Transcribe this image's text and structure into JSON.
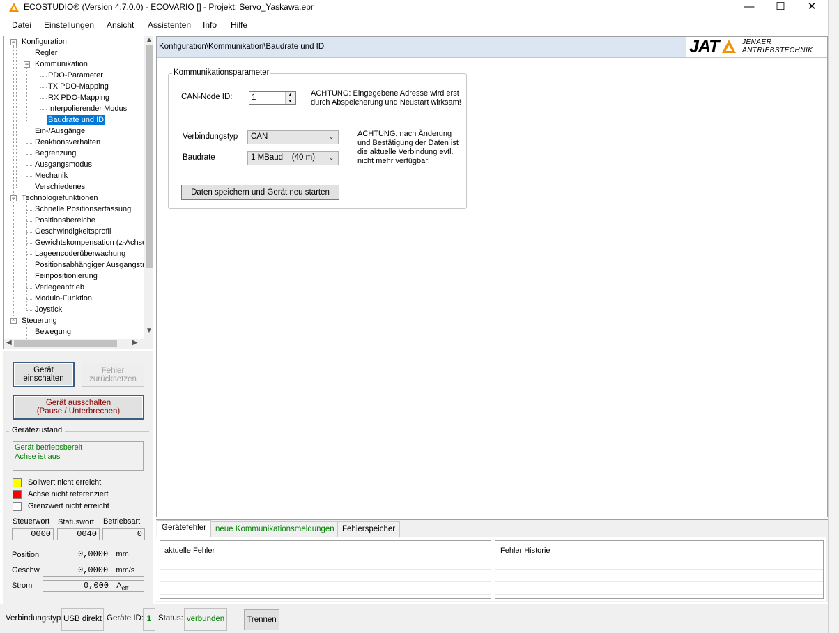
{
  "window": {
    "title": "ECOSTUDIO® (Version 4.7.0.0) - ECOVARIO [] - Projekt: Servo_Yaskawa.epr",
    "minimize": "—",
    "maximize": "☐",
    "close": "✕"
  },
  "menu": [
    "Datei",
    "Einstellungen",
    "Ansicht",
    "Assistenten",
    "Info",
    "Hilfe"
  ],
  "tree": [
    {
      "label": "Konfiguration",
      "level": 0,
      "expanded": true
    },
    {
      "label": "Regler",
      "level": 1
    },
    {
      "label": "Kommunikation",
      "level": 1,
      "expanded": true
    },
    {
      "label": "PDO-Parameter",
      "level": 2
    },
    {
      "label": "TX PDO-Mapping",
      "level": 2
    },
    {
      "label": "RX PDO-Mapping",
      "level": 2
    },
    {
      "label": "Interpolierender Modus",
      "level": 2
    },
    {
      "label": "Baudrate und ID",
      "level": 2,
      "selected": true
    },
    {
      "label": "Ein-/Ausgänge",
      "level": 1
    },
    {
      "label": "Reaktionsverhalten",
      "level": 1
    },
    {
      "label": "Begrenzung",
      "level": 1
    },
    {
      "label": "Ausgangsmodus",
      "level": 1
    },
    {
      "label": "Mechanik",
      "level": 1
    },
    {
      "label": "Verschiedenes",
      "level": 1
    },
    {
      "label": "Technologiefunktionen",
      "level": 0,
      "expanded": true
    },
    {
      "label": "Schnelle Positionserfassung",
      "level": 1
    },
    {
      "label": "Positionsbereiche",
      "level": 1
    },
    {
      "label": "Geschwindigkeitsprofil",
      "level": 1
    },
    {
      "label": "Gewichtskompensation (z-Achse",
      "level": 1
    },
    {
      "label": "Lageencoderüberwachung",
      "level": 1
    },
    {
      "label": "Positionsabhängiger Ausgangstri",
      "level": 1
    },
    {
      "label": "Feinpositionierung",
      "level": 1
    },
    {
      "label": "Verlegeantrieb",
      "level": 1
    },
    {
      "label": "Modulo-Funktion",
      "level": 1
    },
    {
      "label": "Joystick",
      "level": 1
    },
    {
      "label": "Steuerung",
      "level": 0,
      "expanded": true
    },
    {
      "label": "Bewegung",
      "level": 1
    }
  ],
  "controls": {
    "einschalten": "Gerät einschalten",
    "fehler_reset": "Fehler zurücksetzen",
    "ausschalten_line1": "Gerät ausschalten",
    "ausschalten_line2": "(Pause / Unterbrechen)",
    "geraetezustand_title": "Gerätezustand",
    "zustand_line1": "Gerät betriebsbereit",
    "zustand_line2": "Achse ist aus",
    "indicators": [
      {
        "label": "Sollwert nicht erreicht",
        "color": "#ffff00"
      },
      {
        "label": "Achse nicht referenziert",
        "color": "#ff0000"
      },
      {
        "label": "Grenzwert nicht erreicht",
        "color": "#ffffff"
      }
    ],
    "steuerwort_label": "Steuerwort",
    "statuswort_label": "Statuswort",
    "betriebsart_label": "Betriebsart",
    "steuerwort": "0000",
    "statuswort": "0040",
    "betriebsart": "0",
    "position_label": "Position",
    "position_value": "0,0000",
    "position_unit": "mm",
    "geschw_label": "Geschw.",
    "geschw_value": "0,0000",
    "geschw_unit": "mm/s",
    "strom_label": "Strom",
    "strom_value": "0,000",
    "strom_unit": "A",
    "strom_unit_sub": "eff"
  },
  "main": {
    "path": "Konfiguration\\Kommunikation\\Baudrate und ID",
    "logo_text": "JAT",
    "logo_sub1": "JENAER",
    "logo_sub2": "ANTRIEBSTECHNIK",
    "group_title": "Kommunikationsparameter",
    "node_id_label": "CAN-Node ID:",
    "node_id_value": "1",
    "warning1_line1": "ACHTUNG: Eingegebene Adresse wird erst",
    "warning1_line2": "durch Abspeicherung und Neustart wirksam!",
    "verbindungstyp_label": "Verbindungstyp",
    "verbindungstyp_value": "CAN",
    "baudrate_label": "Baudrate",
    "baudrate_value": "1 MBaud    (40 m)",
    "warning2_line1": "ACHTUNG: nach Änderung",
    "warning2_line2": "und Bestätigung der Daten ist",
    "warning2_line3": "die aktuelle Verbindung evtl.",
    "warning2_line4": "nicht mehr verfügbar!",
    "save_button": "Daten speichern und Gerät neu starten"
  },
  "tabs": {
    "items": [
      "Gerätefehler",
      "neue Kommunikationsmeldungen",
      "Fehlerspeicher"
    ],
    "aktuelle_fehler": "aktuelle Fehler",
    "fehler_historie": "Fehler Historie"
  },
  "statusbar": {
    "verbindungstyp_label": "Verbindungstyp:",
    "verbindungstyp_value": "USB direkt",
    "geraete_id_label": "Geräte ID:",
    "geraete_id_value": "1",
    "status_label": "Status:",
    "status_value": "verbunden",
    "trennen": "Trennen"
  },
  "colors": {
    "accent_green": "#008000",
    "selection_blue": "#0078d7",
    "path_bar": "#dce6f2",
    "logo_orange": "#f39200"
  }
}
